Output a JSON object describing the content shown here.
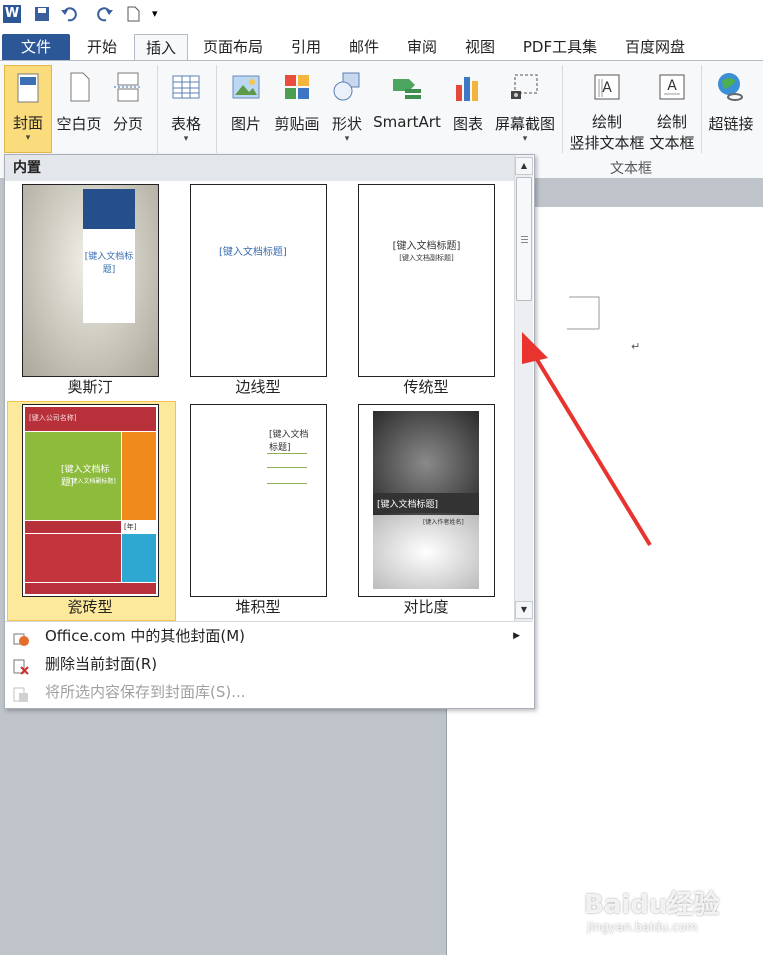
{
  "qat": {
    "icons": [
      "word-logo-icon",
      "save-icon",
      "undo-icon",
      "redo-icon",
      "new-doc-icon",
      "customize-icon"
    ]
  },
  "tabs": [
    {
      "label": "文件"
    },
    {
      "label": "开始"
    },
    {
      "label": "插入"
    },
    {
      "label": "页面布局"
    },
    {
      "label": "引用"
    },
    {
      "label": "邮件"
    },
    {
      "label": "审阅"
    },
    {
      "label": "视图"
    },
    {
      "label": "PDF工具集"
    },
    {
      "label": "百度网盘"
    }
  ],
  "ribbon": {
    "cover": "封面",
    "blank": "空白页",
    "break": "分页",
    "table": "表格",
    "picture": "图片",
    "clipart": "剪贴画",
    "shapes": "形状",
    "smartart": "SmartArt",
    "chart": "图表",
    "screenshot": "屏幕截图",
    "vtext_line1": "绘制",
    "vtext_line2": "竖排文本框",
    "htext_line1": "绘制",
    "htext_line2": "文本框",
    "textbox_group": "文本框",
    "hyperlink": "超链接"
  },
  "gallery": {
    "header": "内置",
    "items": [
      {
        "label": "奥斯汀"
      },
      {
        "label": "边线型"
      },
      {
        "label": "传统型"
      },
      {
        "label": "瓷砖型"
      },
      {
        "label": "堆积型"
      },
      {
        "label": "对比度"
      }
    ],
    "thumb_text": {
      "austin_title": "[键入文档标题]",
      "border_title": "[键入文档标题]",
      "classic_title": "[键入文档标题]",
      "classic_sub": "[键入文档副标题]",
      "tiles_top": "[键入公司名称]",
      "tiles_title": "[键入文档标题]",
      "tiles_sub": "[键入文档副标题]",
      "tiles_year": "[年]",
      "stack_title": "[键入文档标题]",
      "contrast_title": "[键入文档标题]",
      "contrast_author": "[键入作者姓名]"
    }
  },
  "menu": {
    "more_covers": "Office.com 中的其他封面(M)",
    "remove_cover": "删除当前封面(R)",
    "save_selection": "将所选内容保存到封面库(S)..."
  },
  "watermark": {
    "brand": "Baidu经验",
    "url": "jingyan.baidu.com"
  },
  "colors": {
    "accent": "#2b5797",
    "selected": "#fde99c",
    "arrow": "#e8332f"
  }
}
